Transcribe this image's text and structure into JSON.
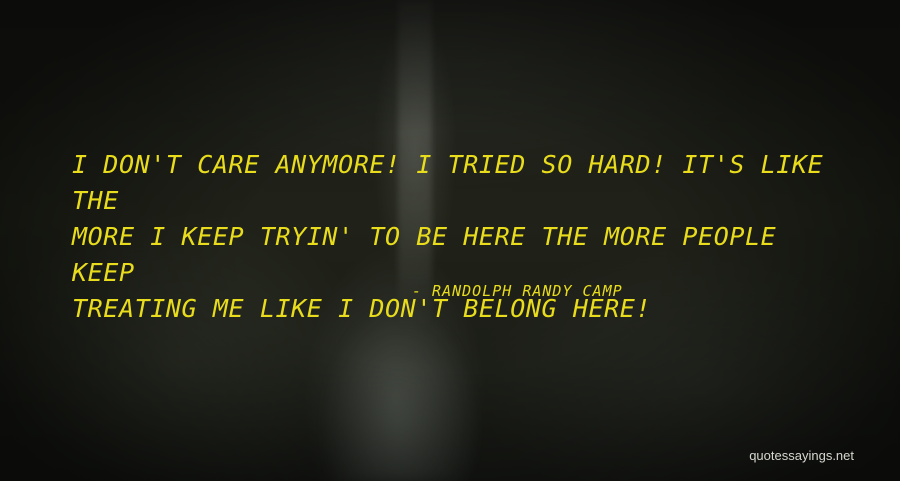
{
  "quote": {
    "text": "I don't care anymore! I tried so hard! It's like the\nmore I keep tryin' to be here the more people keep\ntreating me like I don't belong here!",
    "author": "- RANDOLPH RANDY CAMP"
  },
  "watermark": "quotessayings.net",
  "colors": {
    "quote_text": "#e8dc1c",
    "background": "#1b1c18",
    "watermark_text": "#d6d6d0"
  }
}
